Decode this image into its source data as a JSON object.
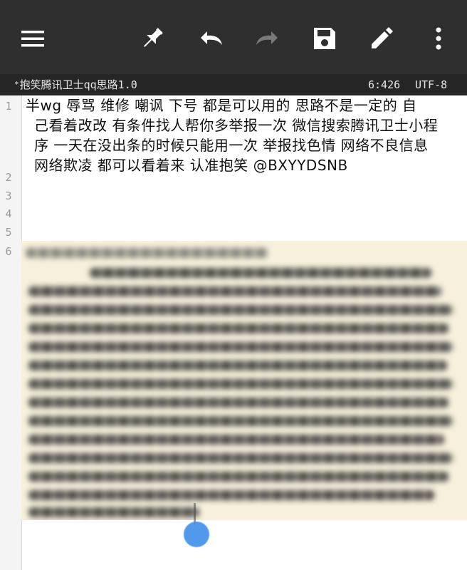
{
  "toolbar": {
    "icons": [
      "menu-icon",
      "pin-icon",
      "undo-icon",
      "redo-icon",
      "save-icon",
      "edit-icon",
      "more-vert-icon"
    ],
    "colors": {
      "background": "#2f2f2f",
      "icon": "#ffffff",
      "disabled_icon": "#7a7a7a"
    }
  },
  "status": {
    "modified_marker": "*",
    "title": "抱笑腾讯卫士qq思路1.0",
    "position": "6:426",
    "encoding": "UTF-8"
  },
  "gutter": {
    "line_numbers": [
      "1",
      "2",
      "3",
      "4",
      "5",
      "6"
    ]
  },
  "document": {
    "lines": [
      "半wg 辱骂 维修 嘲讽 下号 都是可以用的 思路不是一定的 自",
      "己看着改改 有条件找人帮你多举报一次 微信搜索腾讯卫士小程",
      "序 一天在没出条的时候只能用一次 举报找色情 网络不良信息",
      "网络欺凌 都可以看着来 认准抱笑 @BXYYDSNB"
    ]
  },
  "image": {
    "description_label": "blurred-pasted-image",
    "background_color": "#f7f0dc"
  },
  "cursor": {
    "handle_color": "#3f8fe8"
  }
}
